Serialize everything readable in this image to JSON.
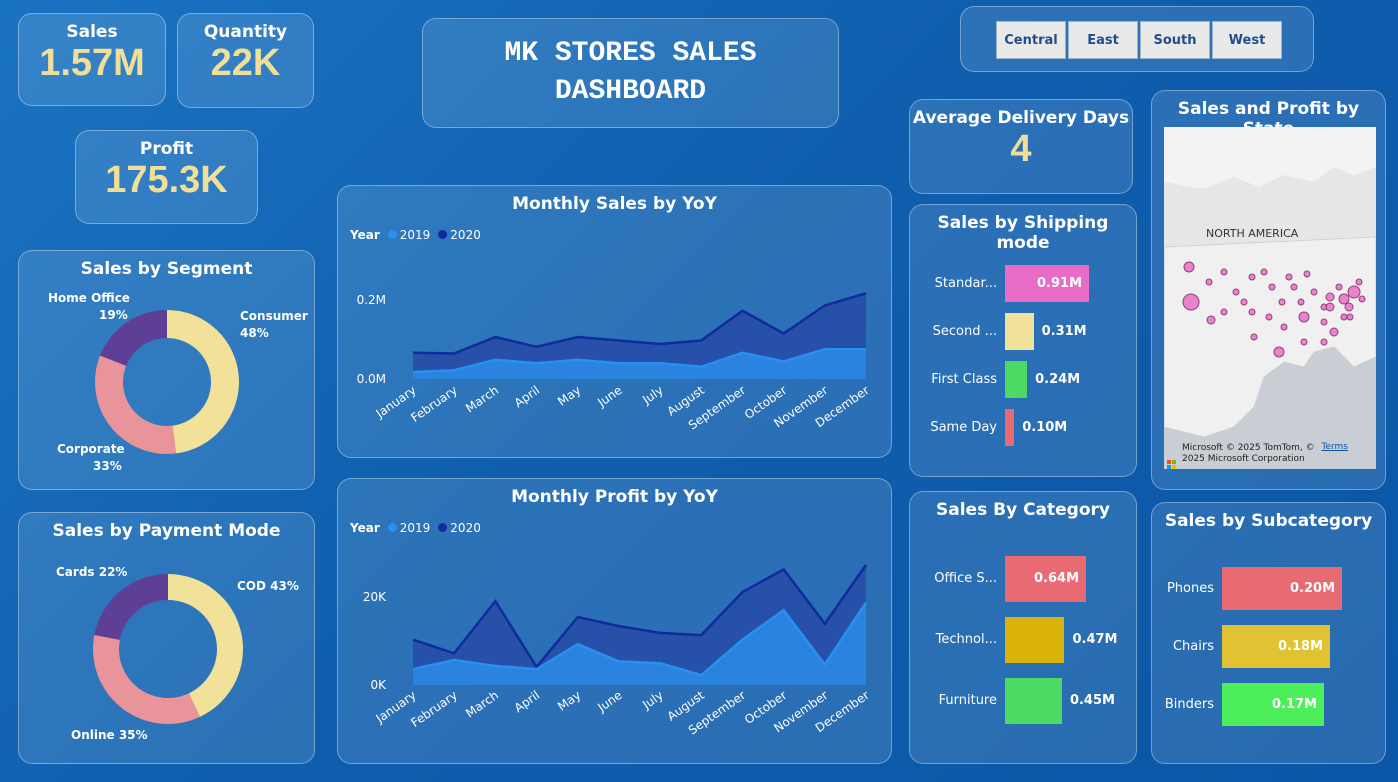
{
  "kpis": {
    "sales": {
      "label": "Sales",
      "value": "1.57M"
    },
    "quantity": {
      "label": "Quantity",
      "value": "22K"
    },
    "profit": {
      "label": "Profit",
      "value": "175.3K"
    },
    "delivery": {
      "label": "Average Delivery Days",
      "value": "4"
    }
  },
  "title": {
    "line1": "MK STORES SALES",
    "line2": "DASHBOARD"
  },
  "slicer": {
    "items": [
      "Central",
      "East",
      "South",
      "West"
    ]
  },
  "segment": {
    "title": "Sales by Segment",
    "slices": [
      {
        "label": "Consumer",
        "pct": "48%",
        "value": 48,
        "color": "#f2e199"
      },
      {
        "label": "Corporate",
        "pct": "33%",
        "value": 33,
        "color": "#e8949a"
      },
      {
        "label": "Home Office",
        "pct": "19%",
        "value": 19,
        "color": "#5e3f96"
      }
    ]
  },
  "payment": {
    "title": "Sales by Payment Mode",
    "slices": [
      {
        "label": "COD 43%",
        "value": 43,
        "color": "#f2e199"
      },
      {
        "label": "Online 35%",
        "value": 35,
        "color": "#e8949a"
      },
      {
        "label": "Cards 22%",
        "value": 22,
        "color": "#5e3f96"
      }
    ]
  },
  "sales_chart": {
    "title": "Monthly Sales by YoY",
    "legend_title": "Year",
    "series_names": [
      "2019",
      "2020"
    ],
    "y_ticks": [
      "0.2M",
      "0.0M"
    ]
  },
  "profit_chart": {
    "title": "Monthly Profit by YoY",
    "legend_title": "Year",
    "series_names": [
      "2019",
      "2020"
    ],
    "y_ticks": [
      "20K",
      "0K"
    ]
  },
  "chart_data": [
    {
      "type": "area",
      "title": "Monthly Sales by YoY",
      "categories": [
        "January",
        "February",
        "March",
        "April",
        "May",
        "June",
        "July",
        "August",
        "September",
        "October",
        "November",
        "December"
      ],
      "series": [
        {
          "name": "2019",
          "values": [
            0.02,
            0.025,
            0.055,
            0.045,
            0.055,
            0.045,
            0.045,
            0.035,
            0.075,
            0.05,
            0.085,
            0.085
          ]
        },
        {
          "name": "2020",
          "values": [
            0.075,
            0.073,
            0.12,
            0.092,
            0.12,
            0.11,
            0.1,
            0.11,
            0.195,
            0.13,
            0.21,
            0.245
          ]
        }
      ],
      "ylim": [
        0,
        0.28
      ],
      "colors": [
        "#2a8ff0",
        "#0f2b9e"
      ]
    },
    {
      "type": "area",
      "title": "Monthly Profit by YoY",
      "categories": [
        "January",
        "February",
        "March",
        "April",
        "May",
        "June",
        "July",
        "August",
        "September",
        "October",
        "November",
        "December"
      ],
      "series": [
        {
          "name": "2019",
          "values": [
            3500,
            5500,
            4200,
            3500,
            9000,
            5200,
            4800,
            2200,
            10000,
            16500,
            4500,
            18200
          ]
        },
        {
          "name": "2020",
          "values": [
            10000,
            7000,
            18500,
            4000,
            15000,
            13000,
            11500,
            11000,
            20500,
            25500,
            13500,
            26500
          ]
        }
      ],
      "ylim": [
        0,
        30000
      ],
      "colors": [
        "#2a8ff0",
        "#0f2b9e"
      ]
    },
    {
      "type": "bar",
      "title": "Sales by Shipping mode",
      "categories": [
        "Standar...",
        "Second ...",
        "First Class",
        "Same Day"
      ],
      "values": [
        0.91,
        0.31,
        0.24,
        0.1
      ],
      "labels": [
        "0.91M",
        "0.31M",
        "0.24M",
        "0.10M"
      ],
      "colors": [
        "#e86bc5",
        "#f2e199",
        "#4cd964",
        "#e86b73"
      ]
    },
    {
      "type": "bar",
      "title": "Sales By Category",
      "categories": [
        "Office S...",
        "Technol...",
        "Furniture"
      ],
      "values": [
        0.64,
        0.47,
        0.45
      ],
      "labels": [
        "0.64M",
        "0.47M",
        "0.45M"
      ],
      "colors": [
        "#e86b73",
        "#d9b20a",
        "#4cd964"
      ]
    },
    {
      "type": "bar",
      "title": "Sales by Subcategory",
      "categories": [
        "Phones",
        "Chairs",
        "Binders"
      ],
      "values": [
        0.2,
        0.18,
        0.17
      ],
      "labels": [
        "0.20M",
        "0.18M",
        "0.17M"
      ],
      "colors": [
        "#e86b73",
        "#e0c232",
        "#4cee5a"
      ]
    }
  ],
  "map": {
    "title": "Sales and Profit by State",
    "region_label": "NORTH AMERICA",
    "attribution": "© 2025 TomTom, © 2025 Microsoft Corporation",
    "terms": "Terms",
    "brand": "Microsoft"
  }
}
